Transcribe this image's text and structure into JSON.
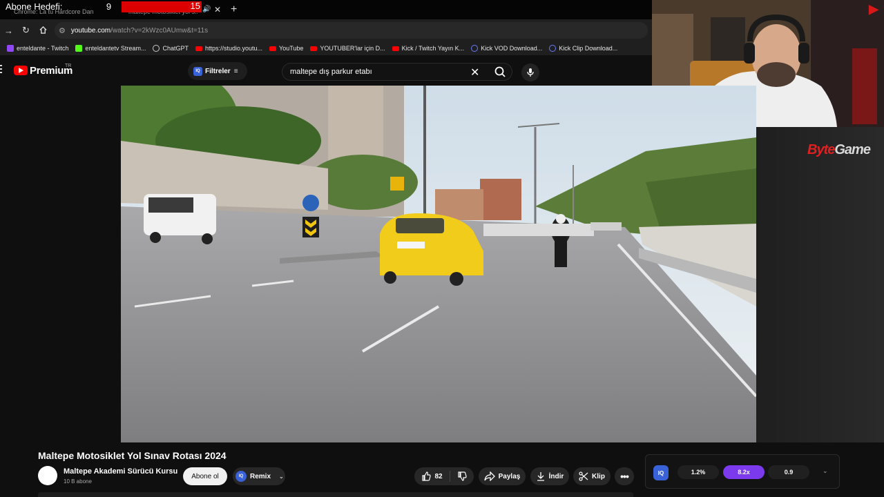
{
  "overlay": {
    "subscriber_goal_label": "Abone Hedefi:",
    "subscriber_current": "9",
    "subscriber_target": "15",
    "subscriber_progress_fraction": 0.6,
    "bar_color": "#dd0000"
  },
  "browser": {
    "tab_ghost_1": "Chrome: La tu Hardcore Dandon",
    "tab_ghost_2": "maltepe motosiklet yol s...",
    "url_domain": "youtube.com",
    "url_path": "/watch?v=2kWzc0AUmw&t=11s",
    "bookmarks": [
      {
        "label": "enteldante - Twitch",
        "icon": "twitch-icon",
        "color": "#9146ff"
      },
      {
        "label": "enteldantetv Stream...",
        "icon": "kick-icon",
        "color": "#53fc18"
      },
      {
        "label": "ChatGPT",
        "icon": "chatgpt-icon",
        "color": "#cccccc"
      },
      {
        "label": "https://studio.youtu...",
        "icon": "youtube-icon",
        "color": "#ff0000"
      },
      {
        "label": "YouTube",
        "icon": "youtube-icon",
        "color": "#ff0000"
      },
      {
        "label": "YOUTUBER'lar için D...",
        "icon": "youtube-icon",
        "color": "#ff0000"
      },
      {
        "label": "Kick / Twitch Yayın K...",
        "icon": "youtube-icon",
        "color": "#ff0000"
      },
      {
        "label": "Kick VOD Download...",
        "icon": "download-site-icon",
        "color": "#6a7cff"
      },
      {
        "label": "Kick Clip Download...",
        "icon": "download-site-icon",
        "color": "#6a7cff"
      }
    ]
  },
  "youtube": {
    "logo_text": "Premium",
    "region": "TR",
    "filters_label": "Filtreler",
    "search_query": "maltepe dış parkur etabı"
  },
  "video": {
    "title": "Maltepe Motosiklet Yol Sınav Rotası 2024",
    "channel_name": "Maltepe Akademi Sürücü Kursu",
    "channel_subs": "10 B abone",
    "subscribe_label": "Abone ol",
    "remix_label": "Remix",
    "like_count": "82",
    "share_label": "Paylaş",
    "download_label": "İndir",
    "clip_label": "Klip"
  },
  "iq_panel": {
    "logo": "IQ",
    "value_1": "1.2%",
    "value_2": "8.2x",
    "value_3": "0.9",
    "accent": "#7c3aed"
  },
  "stream_overlay_logo_a": "Byte",
  "stream_overlay_logo_b": "Game"
}
